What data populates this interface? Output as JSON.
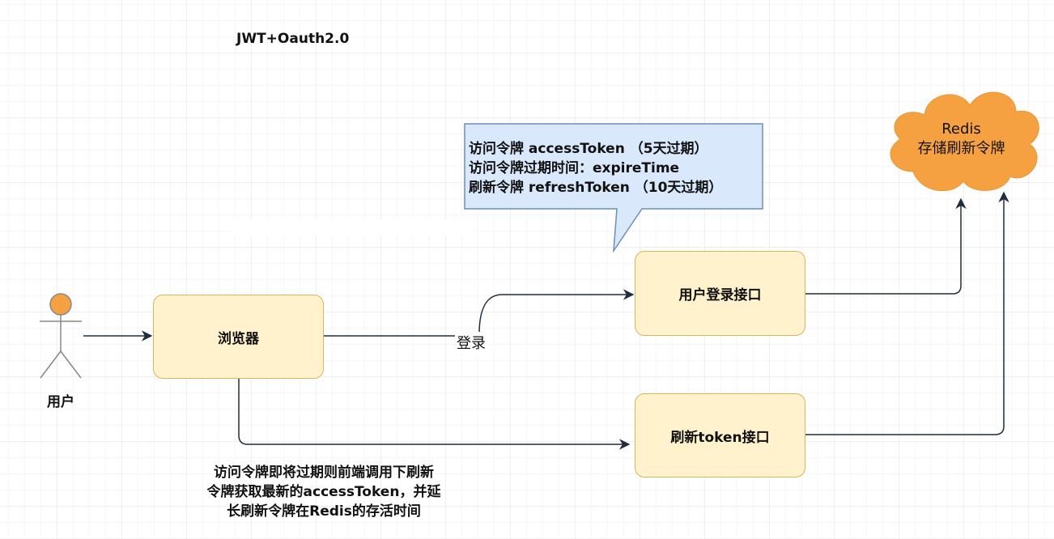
{
  "title": "JWT+Oauth2.0",
  "callout": {
    "lines": [
      "访问令牌 accessToken  （5天过期）",
      "访问令牌过期时间：expireTime",
      "刷新令牌 refreshToken  （10天过期）"
    ],
    "fill": "#dae8fc",
    "stroke": "#6c8ebf"
  },
  "actor": {
    "label": "用户",
    "head_color": "#f5a142"
  },
  "nodes": {
    "browser": "浏览器",
    "login_api": "用户登录接口",
    "refresh_api": "刷新token接口"
  },
  "cloud": {
    "line1": "Redis",
    "line2": "存储刷新令牌",
    "fill": "#f5a142"
  },
  "edges": {
    "login_label": "登录"
  },
  "note": {
    "lines": [
      "访问令牌即将过期则前端调用下刷新",
      "令牌获取最新的accessToken，并延",
      "长刷新令牌在Redis的存活时间"
    ]
  },
  "colors": {
    "box_fill": "#fff2cc",
    "box_stroke": "#d6b656",
    "edge": "#1f2d3d"
  }
}
